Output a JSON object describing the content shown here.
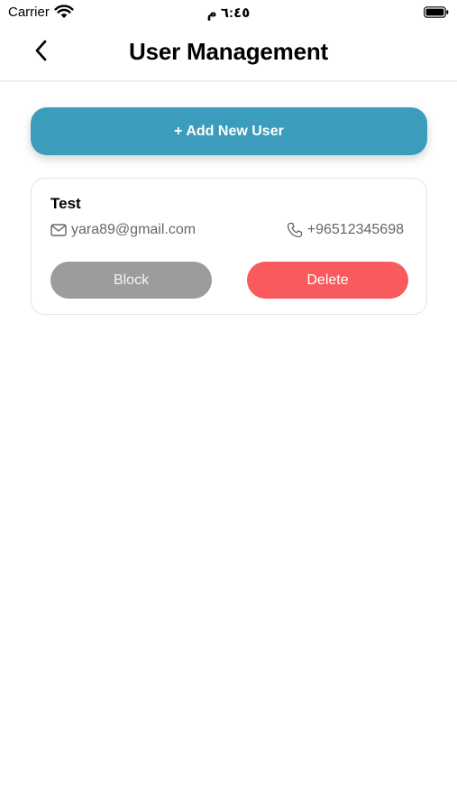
{
  "status_bar": {
    "carrier": "Carrier",
    "time": "٦:٤٥ م",
    "wifi_icon": "wifi-icon",
    "battery_icon": "battery-icon"
  },
  "header": {
    "title": "User Management",
    "back_icon": "chevron-left-icon"
  },
  "add_user": {
    "label": "+ Add New User",
    "color": "#3c9cbc"
  },
  "users": [
    {
      "name": "Test",
      "email": "yara89@gmail.com",
      "phone": "+96512345698",
      "email_icon": "mail-icon",
      "phone_icon": "phone-icon",
      "block_label": "Block",
      "delete_label": "Delete"
    }
  ],
  "colors": {
    "block": "#9c9c9c",
    "delete": "#f85a5e"
  }
}
